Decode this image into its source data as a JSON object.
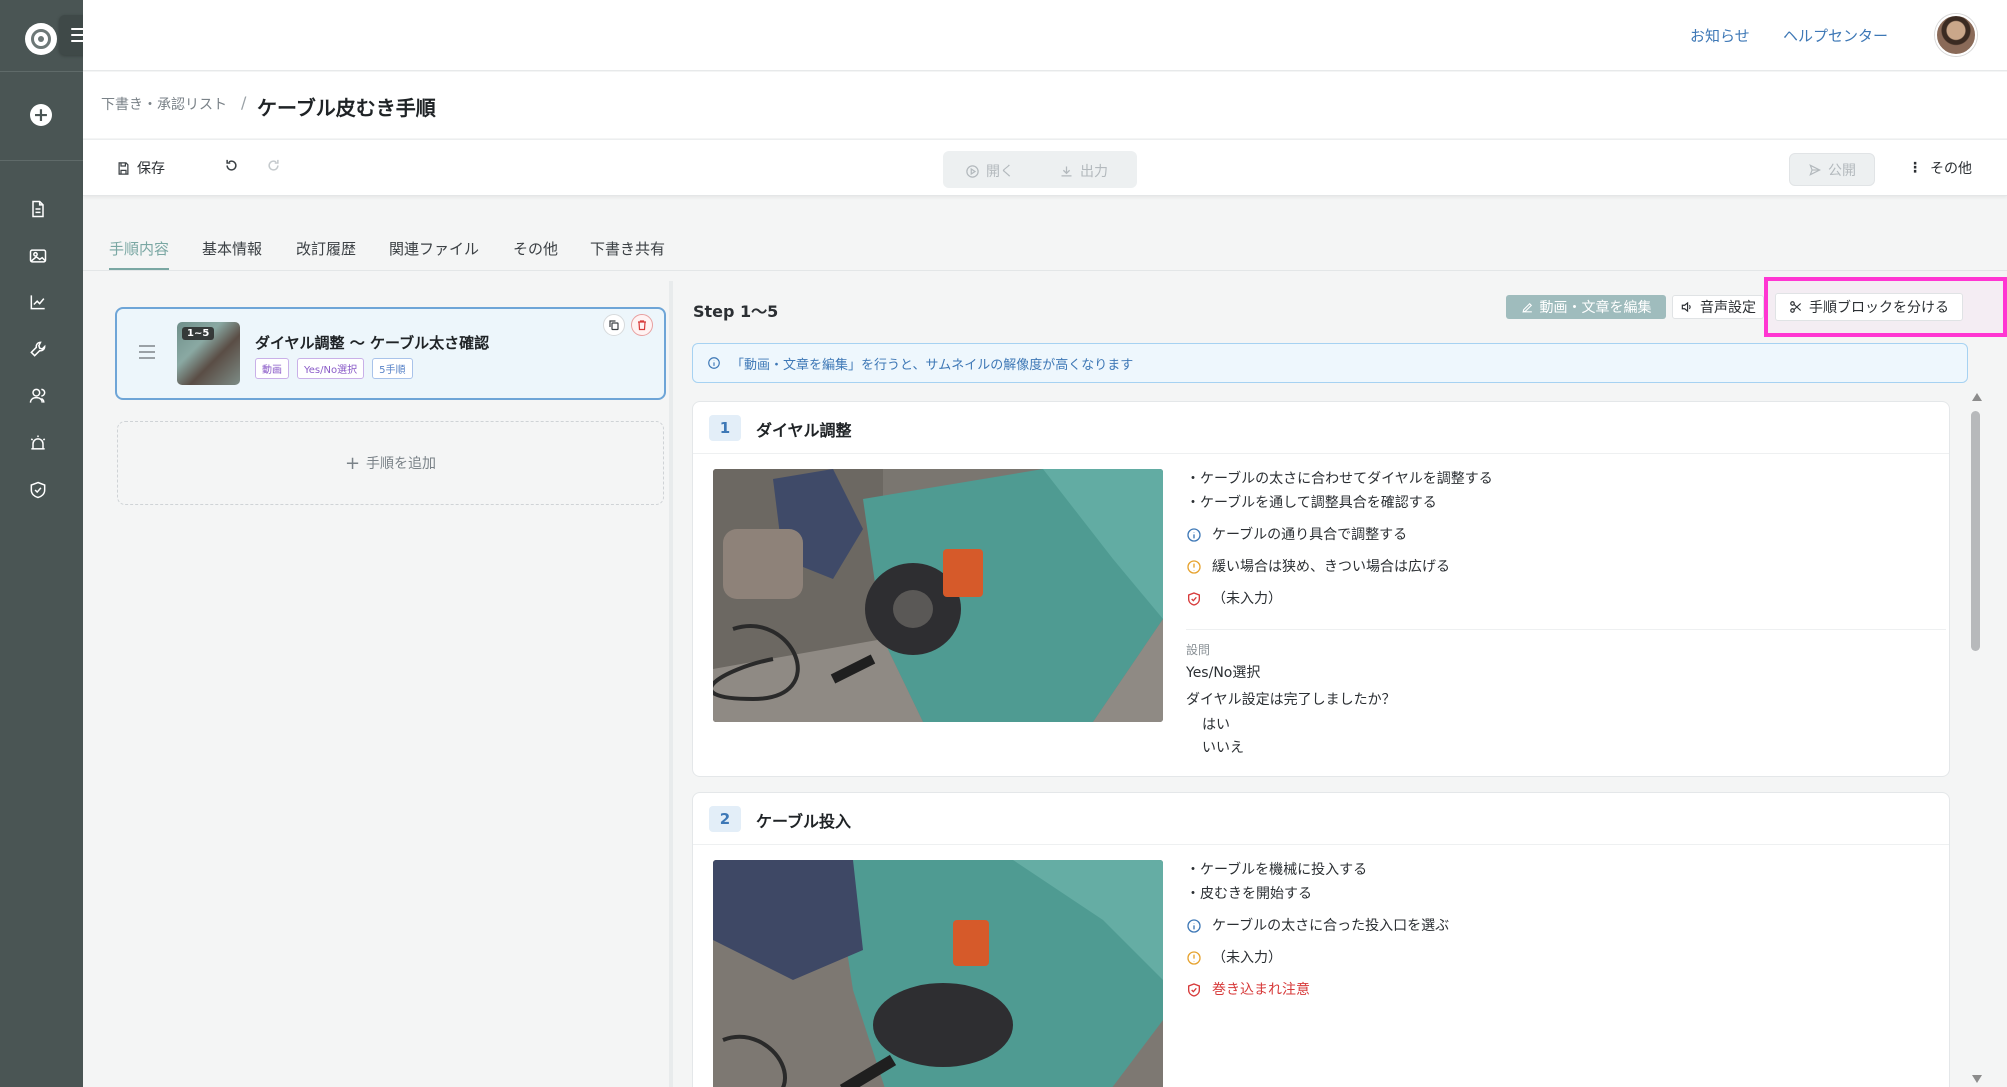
{
  "colors": {
    "sidebar": "#4a5554",
    "accent": "#7aa7a3",
    "link": "#3e78b6",
    "highlight": "#ff36d2",
    "danger": "#d73a3a",
    "warning": "#e6a22e"
  },
  "header": {
    "links": [
      "お知らせ",
      "ヘルプセンター"
    ]
  },
  "breadcrumb": {
    "parent": "下書き・承認リスト",
    "separator": "/",
    "title": "ケーブル皮むき手順"
  },
  "toolbar": {
    "save": "保存",
    "open": "開く",
    "export": "出力",
    "publish": "公開",
    "more": "その他"
  },
  "tabs": [
    "手順内容",
    "基本情報",
    "改訂履歴",
    "関連ファイル",
    "その他",
    "下書き共有"
  ],
  "active_tab": "手順内容",
  "block": {
    "badge": "1~5",
    "title": "ダイヤル調整 〜 ケーブル太さ確認",
    "chips": [
      "動画",
      "Yes/No選択",
      "5手順"
    ]
  },
  "add_step": "手順を追加",
  "right": {
    "range": "Step 1〜5",
    "edit_button": "動画・文章を編集",
    "voice_button": "音声設定",
    "split_button": "手順ブロックを分ける",
    "info": "「動画・文章を編集」を行うと、サムネイルの解像度が高くなります"
  },
  "steps": [
    {
      "number": "1",
      "title": "ダイヤル調整",
      "bullets": [
        "・ケーブルの太さに合わせてダイヤルを調整する",
        "・ケーブルを通して調整具合を確認する"
      ],
      "info_note": "ケーブルの通り具合で調整する",
      "warning_note": "緩い場合は狭め、きつい場合は広げる",
      "safety_note": "（未入力）",
      "question": {
        "label": "設問",
        "type": "Yes/No選択",
        "text": "ダイヤル設定は完了しましたか？",
        "options": [
          "はい",
          "いいえ"
        ]
      }
    },
    {
      "number": "2",
      "title": "ケーブル投入",
      "bullets": [
        "・ケーブルを機械に投入する",
        "・皮むきを開始する"
      ],
      "info_note": "ケーブルの太さに合った投入口を選ぶ",
      "warning_note": "（未入力）",
      "safety_note": "巻き込まれ注意"
    }
  ],
  "icons": {
    "sidebar": [
      "document-icon",
      "image-icon",
      "chart-icon",
      "wrench-icon",
      "users-icon",
      "alarm-icon",
      "shield-check-icon"
    ]
  }
}
